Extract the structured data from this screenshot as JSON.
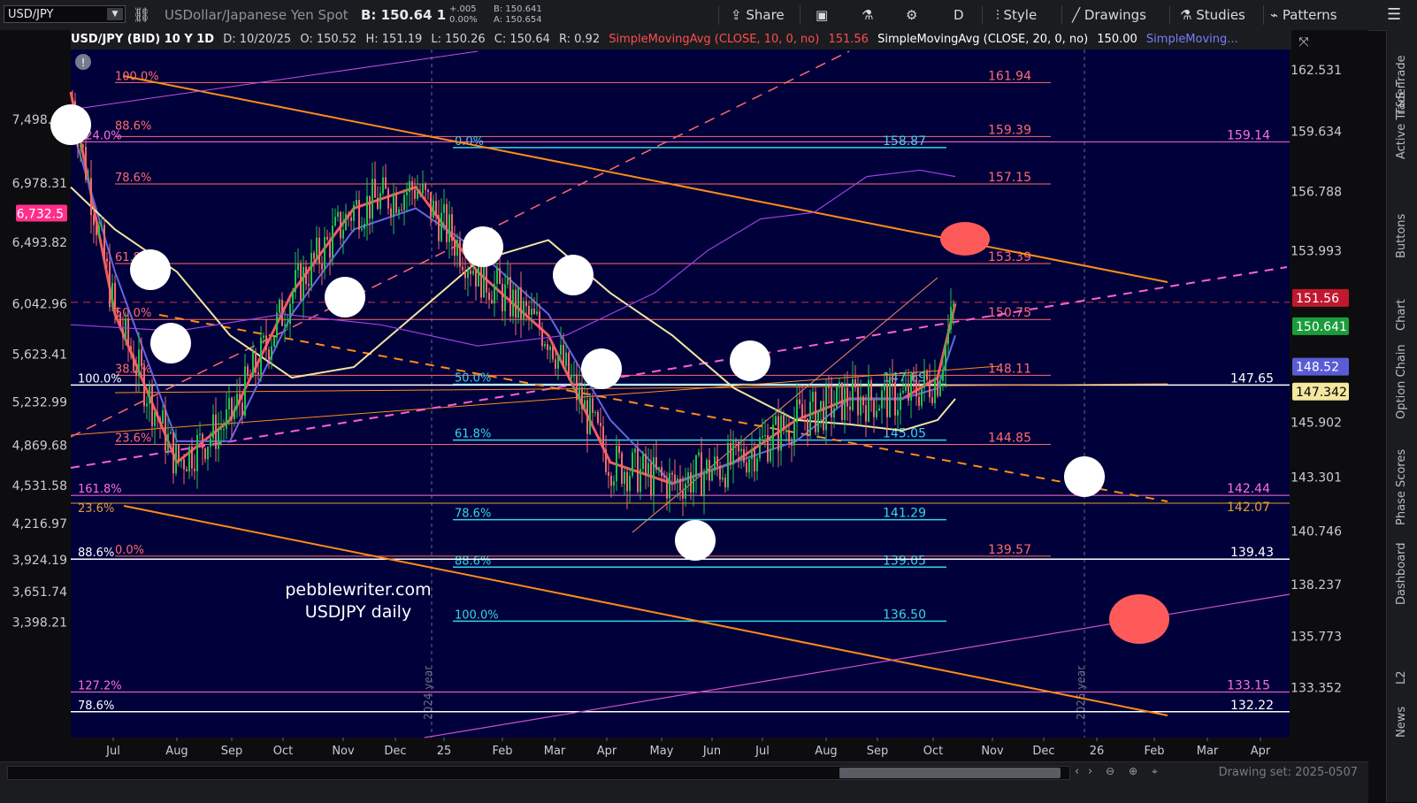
{
  "toolbar": {
    "symbol": "USD/JPY",
    "description": "USDollar/Japanese Yen Spot",
    "bid": "B: 150.64 1",
    "change": "+.005",
    "change_pct": "0.00%",
    "quote_b": "B: 150.641",
    "quote_a": "A: 150.654",
    "share": "Share",
    "period": "D",
    "style": "Style",
    "drawings": "Drawings",
    "studies": "Studies",
    "patterns": "Patterns"
  },
  "header": {
    "title": "USD/JPY (BID) 10 Y 1D",
    "date": "D: 10/20/25",
    "open": "O: 150.52",
    "high": "H: 151.19",
    "low": "L: 150.26",
    "close": "C: 150.64",
    "range": "R: 0.92",
    "sma10": "SimpleMovingAvg (CLOSE, 10, 0, no)",
    "sma10_val": "151.56",
    "sma20": "SimpleMovingAvg (CLOSE, 20, 0, no)",
    "sma20_val": "150.00",
    "sma_more": "SimpleMoving..."
  },
  "side_tabs": [
    "Trade",
    "T&S",
    "Active Trader",
    "Buttons",
    "Chart",
    "Option Chain",
    "Phase Scores",
    "Dashboard",
    "L2",
    "News"
  ],
  "bottom": {
    "drawing_set": "Drawing set: 2025-0507"
  },
  "watermark": {
    "line1": "pebblewriter.com",
    "line2": "USDJPY daily"
  },
  "year_labels": [
    "2024 year",
    "2025 year"
  ],
  "colors": {
    "bg": "#00003a",
    "up": "#21c24a",
    "down": "#f26a6a",
    "orange": "#ff8c1a",
    "cyan": "#35d6e8",
    "pink": "#ff6fd8",
    "salmon": "#ff6b6b",
    "white": "#ffffff"
  },
  "chart_data": {
    "type": "line",
    "title": "USD/JPY (BID) 10 Y 1D",
    "x": [
      "Jul",
      "Aug",
      "Sep",
      "Oct",
      "Nov",
      "Dec",
      "25",
      "Feb",
      "Mar",
      "Apr",
      "May",
      "Jun",
      "Jul",
      "Aug",
      "Sep",
      "Oct",
      "Nov",
      "Dec",
      "26",
      "Feb",
      "Mar",
      "Apr"
    ],
    "right_axis": [
      "162.531",
      "159.634",
      "156.788",
      "153.993",
      "151.56",
      "150.641",
      "148.52",
      "147.342",
      "145.902",
      "143.301",
      "140.746",
      "138.237",
      "135.773",
      "133.352"
    ],
    "left_axis": [
      "7,498.94",
      "6,978.31",
      "6,732.5",
      "6,493.82",
      "6,042.96",
      "5,623.41",
      "5,232.99",
      "4,869.68",
      "4,531.58",
      "4,216.97",
      "3,924.19",
      "3,651.74",
      "3,398.21"
    ],
    "ylim": [
      131,
      163.5
    ],
    "price_labels": [
      {
        "label": "151.56",
        "color": "#c0182e"
      },
      {
        "label": "150.641",
        "color": "#1a9c3b"
      },
      {
        "label": "148.52",
        "color": "#5a5cd6"
      },
      {
        "label": "147.342",
        "color": "#f4e7a0"
      }
    ],
    "levels_red": [
      "161.94",
      "159.39",
      "157.15",
      "153.39",
      "150.75",
      "148.11",
      "144.85",
      "139.57"
    ],
    "levels_cyan": [
      "158.87",
      "147.69",
      "145.05",
      "141.29",
      "139.05",
      "136.50"
    ],
    "fib_cyan_labels": [
      "0.0%",
      "50.0%",
      "61.8%",
      "78.6%",
      "88.6%",
      "100.0%"
    ],
    "fib_red_labels": [
      "100.0%",
      "88.6%",
      "78.6%",
      "61.8%",
      "50.0%",
      "38.2%",
      "23.6%",
      "0.0%"
    ],
    "white_levels": [
      "147.65",
      "139.43",
      "132.22"
    ],
    "white_level_fibs": [
      "100.0%",
      "88.6%",
      "78.6%"
    ],
    "pink_levels": [
      "159.14",
      "142.44",
      "133.15"
    ],
    "pink_fibs": [
      "224.0%",
      "161.8%",
      "127.2%"
    ],
    "orange_level": "142.07",
    "orange_fib": "23.6%",
    "series": [
      {
        "name": "SimpleMovingAvg (CLOSE, 10, 0, no)",
        "values": [
          161.5,
          151,
          144,
          146,
          152,
          156,
          157,
          153,
          150,
          144,
          143,
          144,
          146,
          147,
          147,
          148,
          151.5
        ]
      },
      {
        "name": "SimpleMovingAvg (CLOSE, 20, 0, no)",
        "values": [
          160,
          153,
          145,
          145,
          151,
          155,
          156,
          154,
          151,
          146,
          143,
          144,
          145,
          147,
          147,
          147.5,
          150
        ]
      }
    ]
  }
}
